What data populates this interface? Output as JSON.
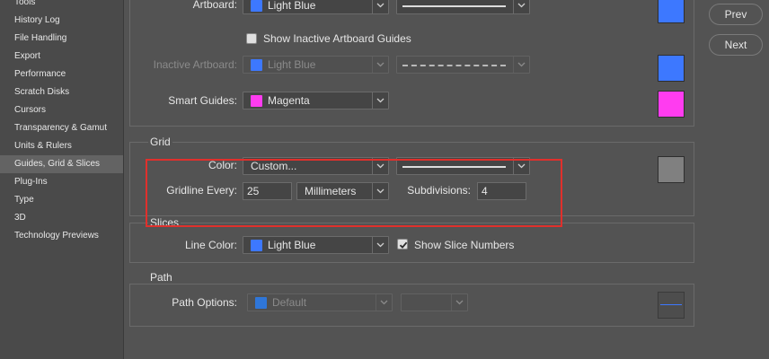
{
  "sidebar": {
    "items": [
      {
        "label": "Tools"
      },
      {
        "label": "History Log"
      },
      {
        "label": "File Handling"
      },
      {
        "label": "Export"
      },
      {
        "label": "Performance"
      },
      {
        "label": "Scratch Disks"
      },
      {
        "label": "Cursors"
      },
      {
        "label": "Transparency & Gamut"
      },
      {
        "label": "Units & Rulers"
      },
      {
        "label": "Guides, Grid & Slices",
        "selected": true
      },
      {
        "label": "Plug-Ins"
      },
      {
        "label": "Type"
      },
      {
        "label": "3D"
      },
      {
        "label": "Technology Previews"
      }
    ]
  },
  "buttons": {
    "prev": "Prev",
    "next": "Next"
  },
  "guides": {
    "artboard_label": "Artboard:",
    "artboard_color": "Light Blue",
    "artboard_swatch": "#3d78ff",
    "show_inactive_label": "Show Inactive Artboard Guides",
    "show_inactive_checked": false,
    "inactive_label": "Inactive Artboard:",
    "inactive_color": "Light Blue",
    "smart_label": "Smart Guides:",
    "smart_color": "Magenta",
    "smart_swatch": "#ff3cf0"
  },
  "grid": {
    "title": "Grid",
    "color_label": "Color:",
    "color_value": "Custom...",
    "gridline_label": "Gridline Every:",
    "gridline_value": "25",
    "unit_value": "Millimeters",
    "subdivisions_label": "Subdivisions:",
    "subdivisions_value": "4",
    "swatch": "#808080"
  },
  "slices": {
    "title": "Slices",
    "line_color_label": "Line Color:",
    "line_color_value": "Light Blue",
    "show_numbers_label": "Show Slice Numbers",
    "show_numbers_checked": true
  },
  "path": {
    "title": "Path",
    "options_label": "Path Options:",
    "options_value": "Default"
  },
  "colors": {
    "light_blue": "#3d78ff",
    "magenta": "#ff3cf0",
    "highlight": "#e0302c"
  }
}
